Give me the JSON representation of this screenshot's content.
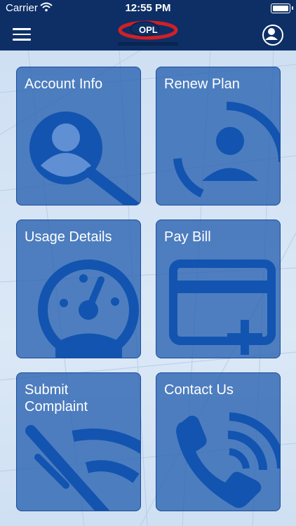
{
  "status_bar": {
    "carrier": "Carrier",
    "time": "12:55 PM"
  },
  "nav": {
    "menu_icon": "hamburger-menu-icon",
    "logo_icon": "company-logo",
    "profile_icon": "user-profile-icon"
  },
  "tiles": [
    {
      "label": "Account Info",
      "icon": "search-user-icon"
    },
    {
      "label": "Renew Plan",
      "icon": "user-refresh-icon"
    },
    {
      "label": "Usage Details",
      "icon": "speedometer-icon"
    },
    {
      "label": "Pay Bill",
      "icon": "credit-card-add-icon"
    },
    {
      "label": "Submit Complaint",
      "icon": "wifi-off-icon"
    },
    {
      "label": "Contact Us",
      "icon": "phone-call-icon"
    }
  ],
  "colors": {
    "header": "#0d2f66",
    "tile": "#2660b0",
    "icon": "#1254b0"
  }
}
